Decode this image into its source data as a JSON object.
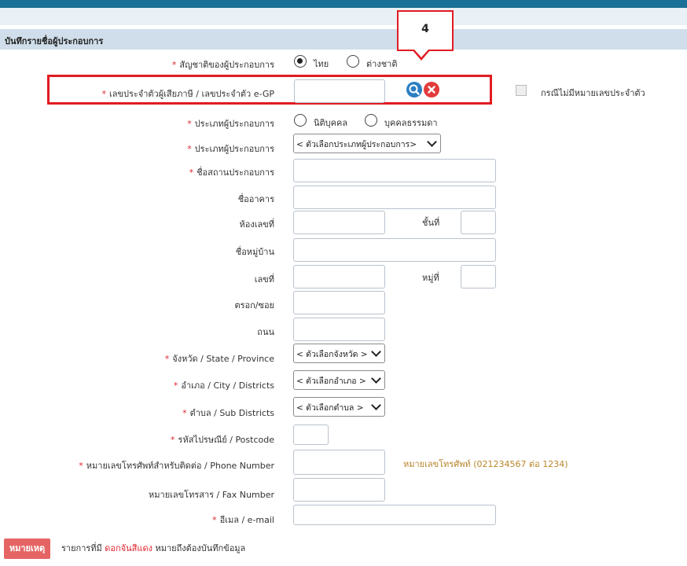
{
  "section_title": "บันทึกรายชื่อผู้ประกอบการ",
  "callout_number": "4",
  "nationality": {
    "label": "สัญชาติของผู้ประกอบการ",
    "options": [
      "ไทย",
      "ต่างชาติ"
    ],
    "selected": "ไทย"
  },
  "tax_id": {
    "label": "เลขประจำตัวผู้เสียภาษี / เลขประจำตัว e-GP",
    "value": "",
    "search_icon": "search-icon",
    "clear_icon": "close-icon",
    "no_id_checkbox_label": "กรณีไม่มีหมายเลขประจำตัว"
  },
  "entity_type": {
    "label": "ประเภทผู้ประกอบการ",
    "options": [
      "นิติบุคคล",
      "บุคคลธรรมดา"
    ]
  },
  "operator_type": {
    "label": "ประเภทผู้ประกอบการ",
    "selected": "< ตัวเลือกประเภทผู้ประกอบการ>"
  },
  "establishment_name": {
    "label": "ชื่อสถานประกอบการ",
    "value": ""
  },
  "building_name": {
    "label": "ชื่ออาคาร",
    "value": ""
  },
  "room_no": {
    "label": "ห้องเลขที่",
    "value": ""
  },
  "floor": {
    "label": "ชั้นที่",
    "value": ""
  },
  "village": {
    "label": "ชื่อหมู่บ้าน",
    "value": ""
  },
  "house_no": {
    "label": "เลขที่",
    "value": ""
  },
  "moo": {
    "label": "หมู่ที่",
    "value": ""
  },
  "soi": {
    "label": "ตรอก/ซอย",
    "value": ""
  },
  "road": {
    "label": "ถนน",
    "value": ""
  },
  "province": {
    "label": "จังหวัด / State / Province",
    "selected": "< ตัวเลือกจังหวัด >"
  },
  "district": {
    "label": "อำเภอ / City / Districts",
    "selected": "< ตัวเลือกอำเภอ >"
  },
  "subdistrict": {
    "label": "ตำบล / Sub Districts",
    "selected": "< ตัวเลือกตำบล >"
  },
  "postcode": {
    "label": "รหัสไปรษณีย์ / Postcode",
    "value": ""
  },
  "phone": {
    "label": "หมายเลขโทรศัพท์สำหรับติดต่อ / Phone Number",
    "value": "",
    "hint": "หมายเลขโทรศัพท์ (021234567 ต่อ 1234)"
  },
  "fax": {
    "label": "หมายเลขโทรสาร / Fax Number",
    "value": ""
  },
  "email": {
    "label": "อีเมล / e-mail",
    "value": ""
  },
  "note": {
    "button": "หมายเหตุ",
    "text_before": "รายการที่มี",
    "text_red": "ดอกจันสีแดง",
    "text_after": "หมายถึงต้องบันทึกข้อมูล"
  },
  "required_marker": "*",
  "colors": {
    "header_bar": "#1a7096",
    "section_bg": "#cfdeea",
    "required": "#e0262f",
    "highlight": "#e11b22",
    "hint": "#b8862a",
    "note_button": "#e56565"
  }
}
